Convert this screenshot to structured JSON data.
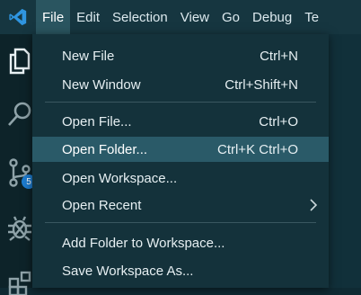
{
  "menubar": {
    "items": [
      "File",
      "Edit",
      "Selection",
      "View",
      "Go",
      "Debug",
      "Te"
    ]
  },
  "activitybar": {
    "icons": [
      "files-icon",
      "search-icon",
      "source-control-icon",
      "debug-icon",
      "extensions-icon"
    ],
    "source_control_badge": "5"
  },
  "file_menu": {
    "items": [
      {
        "label": "New File",
        "shortcut": "Ctrl+N"
      },
      {
        "label": "New Window",
        "shortcut": "Ctrl+Shift+N"
      },
      {
        "label": "Open File...",
        "shortcut": "Ctrl+O"
      },
      {
        "label": "Open Folder...",
        "shortcut": "Ctrl+K Ctrl+O"
      },
      {
        "label": "Open Workspace...",
        "shortcut": ""
      },
      {
        "label": "Open Recent",
        "shortcut": ""
      },
      {
        "label": "Add Folder to Workspace...",
        "shortcut": ""
      },
      {
        "label": "Save Workspace As...",
        "shortcut": ""
      }
    ],
    "highlighted": "Open Folder..."
  },
  "colors": {
    "menubar_bg": "#163640",
    "menu_bg": "#14323b",
    "highlight_bg": "#2a5a68",
    "logo_accent": "#2f95e0",
    "badge": "#1d7ccf"
  }
}
